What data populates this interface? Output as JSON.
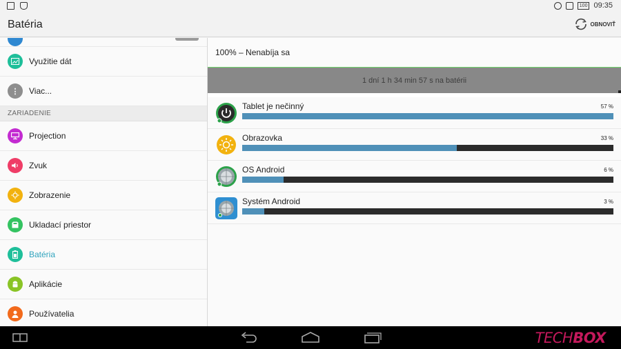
{
  "status_bar": {
    "time": "09:35",
    "battery": "100"
  },
  "action_bar": {
    "title": "Batéria",
    "refresh_label": "OBNOVIŤ"
  },
  "settings": {
    "top_items": [
      {
        "label": "Využitie dát",
        "icon": "data-usage-icon",
        "color": "#1fbf9a"
      },
      {
        "label": "Viac...",
        "icon": "more-icon",
        "color": "#8e8e8e"
      }
    ],
    "section_device": "ZARIADENIE",
    "device_items": [
      {
        "label": "Projection",
        "icon": "projection-icon",
        "color": "#c32bd1"
      },
      {
        "label": "Zvuk",
        "icon": "sound-icon",
        "color": "#ef3d67"
      },
      {
        "label": "Zobrazenie",
        "icon": "display-icon",
        "color": "#f2b20f"
      },
      {
        "label": "Ukladací priestor",
        "icon": "storage-icon",
        "color": "#34c361"
      },
      {
        "label": "Batéria",
        "icon": "battery-icon",
        "color": "#1fbf9a",
        "active": true
      },
      {
        "label": "Aplikácie",
        "icon": "apps-icon",
        "color": "#8ac426"
      },
      {
        "label": "Používatelia",
        "icon": "users-icon",
        "color": "#f26a1c"
      }
    ]
  },
  "battery": {
    "status": "100% – Nenabíja sa",
    "graph_label": "1 dní 1 h 34 min 57 s na batérii",
    "accent_color": "#4f90b8",
    "items": [
      {
        "name": "Tablet je nečinný",
        "pct_label": "57 %",
        "bar_fraction": 1.0,
        "icon": "power-icon"
      },
      {
        "name": "Obrazovka",
        "pct_label": "33 %",
        "bar_fraction": 0.578,
        "icon": "screen-brightness-icon"
      },
      {
        "name": "OS Android",
        "pct_label": "6 %",
        "bar_fraction": 0.111,
        "icon": "android-os-icon"
      },
      {
        "name": "Systém Android",
        "pct_label": "3 %",
        "bar_fraction": 0.06,
        "icon": "android-system-icon"
      }
    ]
  },
  "brand": {
    "part1": "TECH",
    "part2": "BOX"
  }
}
